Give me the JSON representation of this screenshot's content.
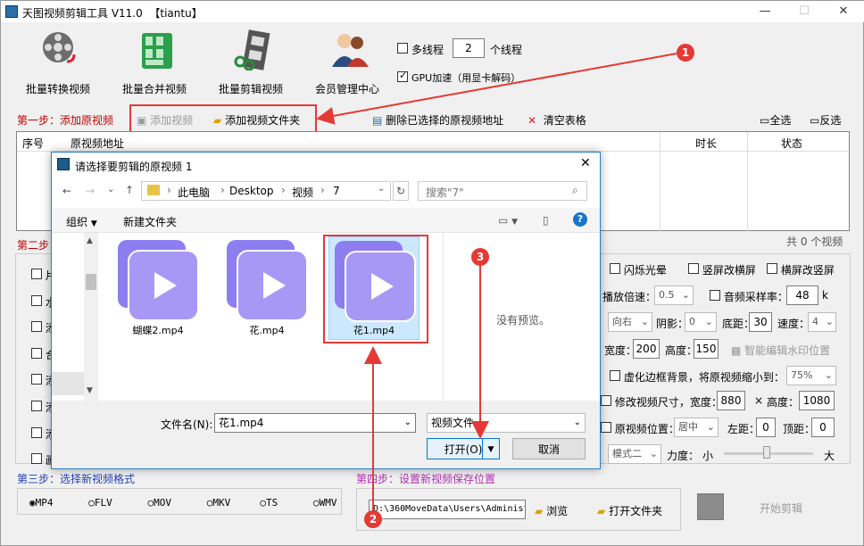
{
  "app": {
    "title": "天图视频剪辑工具 V11.0",
    "tag": "【tiantu】"
  },
  "toolbar": {
    "batch_convert": "批量转换视频",
    "batch_merge": "批量合并视频",
    "batch_cut": "批量剪辑视频",
    "member": "会员管理中心",
    "multithread_label": "多线程",
    "thread_count": "2",
    "thread_suffix": "个线程",
    "gpu_label": "GPU加速（用显卡解码）"
  },
  "step1": {
    "label": "第一步：添加原视频",
    "add_video": "添加视频",
    "add_folder": "添加视频文件夹",
    "delete_selected": "删除已选择的原视频地址",
    "clear_table": "清空表格",
    "select_all": "全选",
    "invert": "反选"
  },
  "table": {
    "col_seq": "序号",
    "col_path": "原视频地址",
    "col_duration": "时长",
    "col_status": "状态",
    "total": "共 0 个视频"
  },
  "step2": {
    "label": "第二步：",
    "flash": "闪烁光晕",
    "landscape_to_portrait": "竖屏改横屏",
    "portrait_to_landscape": "横屏改竖屏",
    "speed_label": "播放倍速：",
    "speed_value": "0.5",
    "sample_label": "音频采样率：",
    "sample_value": "48",
    "sample_unit": "k",
    "direction": "向右",
    "shadow_label": "阴影：",
    "shadow_value": "0",
    "bottom_label": "底距：",
    "bottom_value": "30",
    "velocity_label": "速度：",
    "velocity_value": "4",
    "width_label": "宽度：",
    "width_value": "200",
    "height_label": "高度：",
    "height_value": "150",
    "smart_watermark": "智能编辑水印位置",
    "blur_border": "虚化边框背景，将原视频缩小到：",
    "blur_pct": "75%",
    "resize": "修改视频尺寸，宽度：",
    "resize_w": "880",
    "times": "×",
    "resize_h_label": "高度：",
    "resize_h": "1080",
    "orig_pos": "原视频位置：",
    "orig_pos_value": "居中",
    "left_label": "左距：",
    "left_value": "0",
    "top_label": "顶距：",
    "top_value": "0",
    "mode": "模式二",
    "strength": "力度：",
    "small": "小",
    "large": "大",
    "left_initials": [
      "片",
      "水",
      "添",
      "合",
      "添",
      "添",
      "添",
      "画"
    ]
  },
  "step3": {
    "label": "第三步：选择新视频格式",
    "formats": [
      "MP4",
      "FLV",
      "MOV",
      "MKV",
      "TS",
      "WMV"
    ]
  },
  "step4": {
    "label": "第四步：设置新视频保存位置",
    "path": "D:\\360MoveData\\Users\\Administr",
    "browse": "浏览",
    "open_folder": "打开文件夹",
    "start": "开始剪辑"
  },
  "dialog": {
    "title": "请选择要剪辑的原视频 1",
    "crumbs": [
      "此电脑",
      "Desktop",
      "视频",
      "7"
    ],
    "search_placeholder": "搜索\"7\"",
    "organize": "组织",
    "new_folder": "新建文件夹",
    "files": [
      "蝴蝶2.mp4",
      "花.mp4",
      "花1.mp4"
    ],
    "no_preview": "没有预览。",
    "filename_label": "文件名(N):",
    "filename_value": "花1.mp4",
    "filetype": "视频文件",
    "open": "打开(O)",
    "cancel": "取消"
  },
  "annotations": [
    "1",
    "2",
    "3"
  ],
  "colors": {
    "accent": "#e53935",
    "blue": "#1f3fbf",
    "selected": "#cce8ff"
  }
}
